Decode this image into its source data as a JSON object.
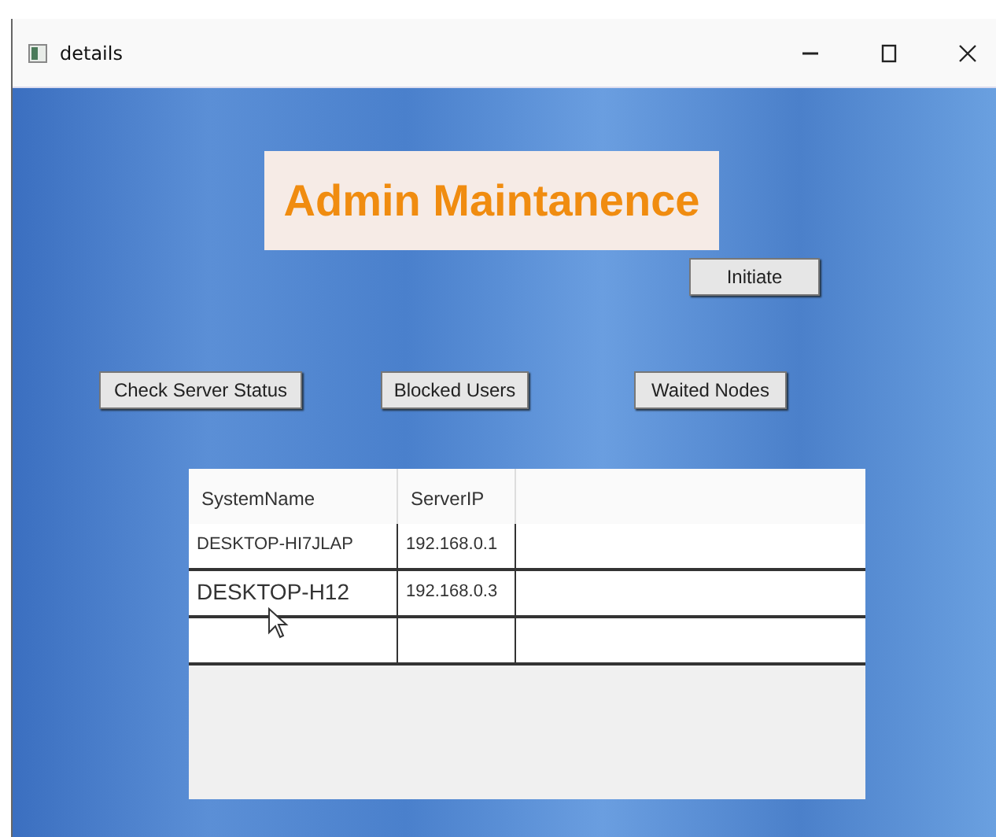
{
  "window": {
    "title": "details"
  },
  "heading": "Admin Maintanence",
  "initiate_button": "Initiate",
  "buttons": [
    "Check Server Status",
    "Blocked Users",
    "Waited Nodes"
  ],
  "table": {
    "columns": [
      "SystemName",
      "ServerIP"
    ],
    "rows": [
      {
        "cells": [
          "DESKTOP-HI7JLAP",
          "192.168.0.1"
        ],
        "large": false
      },
      {
        "cells": [
          "DESKTOP-H12",
          "192.168.0.3"
        ],
        "large": true
      }
    ]
  }
}
